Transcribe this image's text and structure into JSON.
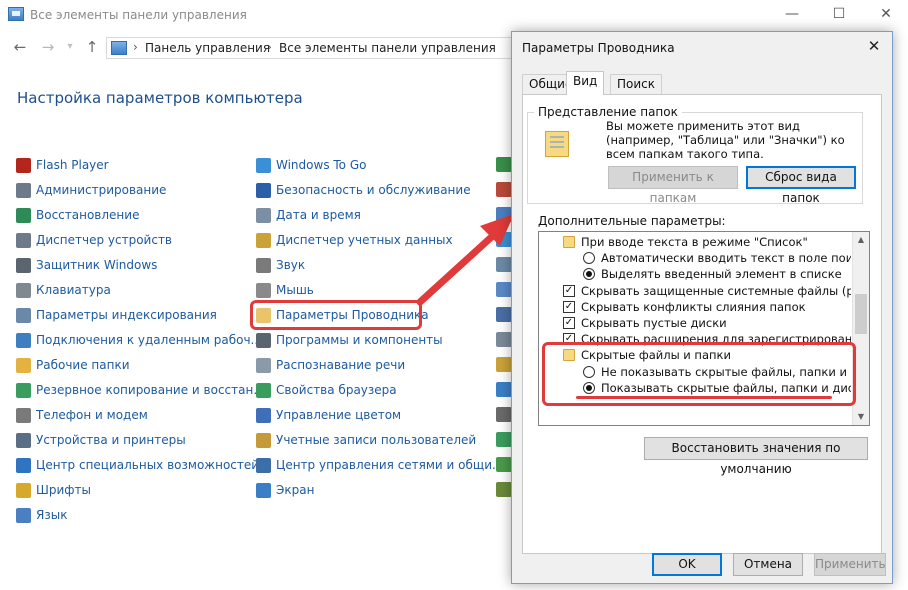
{
  "window": {
    "title": "Все элементы панели управления",
    "minimize": "—",
    "maximize": "☐",
    "close": "✕"
  },
  "nav": {
    "back": "←",
    "forward": "→",
    "up": "↑",
    "breadcrumb": [
      "Панель управления",
      "Все элементы панели управления"
    ],
    "separator": "›"
  },
  "heading": "Настройка параметров компьютера",
  "items_col1": [
    {
      "label": "Flash Player",
      "color": "#b3261e"
    },
    {
      "label": "Администрирование",
      "color": "#6c7a89"
    },
    {
      "label": "Восстановление",
      "color": "#2e8b57"
    },
    {
      "label": "Диспетчер устройств",
      "color": "#6c7a89"
    },
    {
      "label": "Защитник Windows",
      "color": "#5a6570"
    },
    {
      "label": "Клавиатура",
      "color": "#808890"
    },
    {
      "label": "Параметры индексирования",
      "color": "#6b88a8"
    },
    {
      "label": "Подключения к удаленным рабоч...",
      "color": "#3f7fbf"
    },
    {
      "label": "Рабочие папки",
      "color": "#e3b341"
    },
    {
      "label": "Резервное копирование и восстан...",
      "color": "#3a9d5d"
    },
    {
      "label": "Телефон и модем",
      "color": "#7a7a7a"
    },
    {
      "label": "Устройства и принтеры",
      "color": "#5a6f86"
    },
    {
      "label": "Центр специальных возможностей",
      "color": "#2f74c0"
    },
    {
      "label": "Шрифты",
      "color": "#d6a92d"
    },
    {
      "label": "Язык",
      "color": "#4a7fc1"
    }
  ],
  "items_col2": [
    {
      "label": "Windows To Go",
      "color": "#3a8fd6"
    },
    {
      "label": "Безопасность и обслуживание",
      "color": "#2c5fa8"
    },
    {
      "label": "Дата и время",
      "color": "#7d8fa3"
    },
    {
      "label": "Диспетчер учетных данных",
      "color": "#c9a23a"
    },
    {
      "label": "Звук",
      "color": "#7a7a7a"
    },
    {
      "label": "Мышь",
      "color": "#8a8a8a"
    },
    {
      "label": "Параметры Проводника",
      "color": "#e9c46a"
    },
    {
      "label": "Программы и компоненты",
      "color": "#5a6570"
    },
    {
      "label": "Распознавание речи",
      "color": "#8a9aa8"
    },
    {
      "label": "Свойства браузера",
      "color": "#3a9d5d"
    },
    {
      "label": "Управление цветом",
      "color": "#3f6fb8"
    },
    {
      "label": "Учетные записи пользователей",
      "color": "#c49a3a"
    },
    {
      "label": "Центр управления сетями и общи...",
      "color": "#3c6ea8"
    },
    {
      "label": "Экран",
      "color": "#3a7fc6"
    }
  ],
  "col3_icons": [
    {
      "color": "#3a8f4a"
    },
    {
      "color": "#b84a3a"
    },
    {
      "color": "#4a7fc1"
    },
    {
      "color": "#3a8fd6"
    },
    {
      "color": "#6c8aa6"
    },
    {
      "color": "#5a8ac6"
    },
    {
      "color": "#4a6fa6"
    },
    {
      "color": "#7a8a9a"
    },
    {
      "color": "#c9a23a"
    },
    {
      "color": "#3a7fc6"
    },
    {
      "color": "#6a6a6a"
    },
    {
      "color": "#3a9d5d"
    },
    {
      "color": "#4a9a4a"
    },
    {
      "color": "#6a8a3a"
    }
  ],
  "dialog": {
    "title": "Параметры Проводника",
    "close": "✕",
    "tabs": [
      "Общие",
      "Вид",
      "Поиск"
    ],
    "folder_view_label": "Представление папок",
    "folder_view_desc": "Вы можете применить этот вид (например, \"Таблица\" или \"Значки\") ко всем папкам такого типа.",
    "apply_button": "Применить к папкам",
    "reset_button": "Сброс вида папок",
    "advanced_label": "Дополнительные параметры:",
    "tree": [
      {
        "type": "folder",
        "indent": 0,
        "text": "При вводе текста в режиме \"Список\""
      },
      {
        "type": "radio",
        "indent": 1,
        "checked": false,
        "text": "Автоматически вводить текст в поле поиска"
      },
      {
        "type": "radio",
        "indent": 1,
        "checked": true,
        "text": "Выделять введенный элемент в списке"
      },
      {
        "type": "check",
        "indent": 0,
        "checked": true,
        "text": "Скрывать защищенные системные файлы (рекомен..."
      },
      {
        "type": "check",
        "indent": 0,
        "checked": true,
        "text": "Скрывать конфликты слияния папок"
      },
      {
        "type": "check",
        "indent": 0,
        "checked": true,
        "text": "Скрывать пустые диски"
      },
      {
        "type": "check",
        "indent": 0,
        "checked": true,
        "text": "Скрывать расширения для зарегистрированных типо"
      },
      {
        "type": "folder",
        "indent": 0,
        "text": "Скрытые файлы и папки"
      },
      {
        "type": "radio",
        "indent": 1,
        "checked": false,
        "text": "Не показывать скрытые файлы, папки и диски"
      },
      {
        "type": "radio",
        "indent": 1,
        "checked": true,
        "text": "Показывать скрытые файлы, папки и диски"
      }
    ],
    "restore_button": "Восстановить значения по умолчанию",
    "ok_button": "OK",
    "cancel_button": "Отмена",
    "apply_footer_button": "Применить",
    "scroll_up": "▲",
    "scroll_down": "▼"
  },
  "annotation_color": "#e03a3a"
}
